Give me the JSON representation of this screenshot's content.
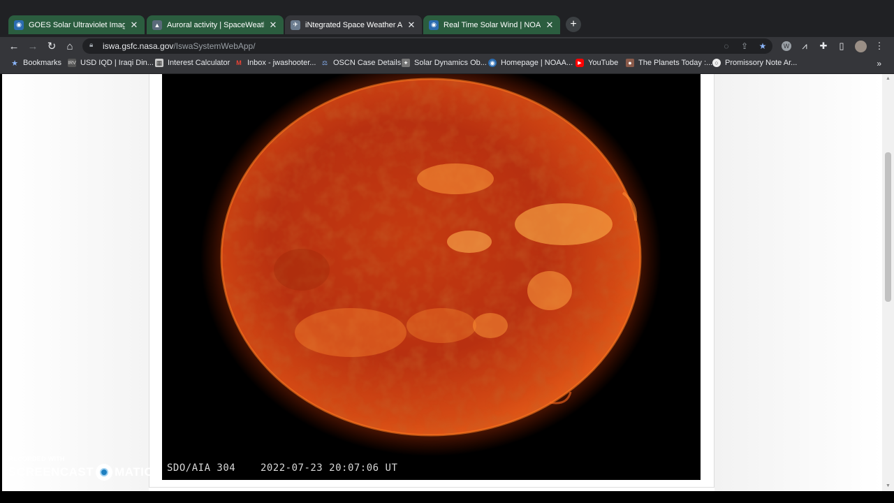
{
  "tabs": [
    {
      "title": "GOES Solar Ultraviolet Imager (SU",
      "icon": "noaa-icon",
      "color": "#2b6cb0"
    },
    {
      "title": "Auroral activity | SpaceWeatherLi",
      "icon": "aurora-icon",
      "color": "#5a6a7a"
    },
    {
      "title": "iNtegrated Space Weather Analy",
      "icon": "nasa-icon",
      "color": "#6b7c8f"
    },
    {
      "title": "Real Time Solar Wind | NOAA / N",
      "icon": "noaa-icon",
      "color": "#2b6cb0"
    }
  ],
  "address": {
    "host": "iswa.gsfc.nasa.gov",
    "path": "/IswaSystemWebApp/"
  },
  "bookmarks": [
    {
      "label": "Bookmarks",
      "icon": "star-icon"
    },
    {
      "label": "USD IQD | Iraqi Din...",
      "icon": "currency-icon"
    },
    {
      "label": "Interest Calculator",
      "icon": "calculator-icon"
    },
    {
      "label": "Inbox - jwashooter...",
      "icon": "gmail-icon"
    },
    {
      "label": "OSCN Case Details",
      "icon": "scales-icon"
    },
    {
      "label": "Solar Dynamics Ob...",
      "icon": "sdo-icon"
    },
    {
      "label": "Homepage | NOAA...",
      "icon": "noaa-icon"
    },
    {
      "label": "YouTube",
      "icon": "youtube-icon"
    },
    {
      "label": "The Planets Today :...",
      "icon": "planets-icon"
    },
    {
      "label": "Promissory Note Ar...",
      "icon": "document-icon"
    }
  ],
  "bookmarks_more": "»",
  "sun_image": {
    "instrument": "SDO/AIA 304",
    "timestamp": "2022-07-23 20:07:06 UT"
  },
  "watermark": {
    "line1": "RECORDED WITH",
    "brand_left": "SCREENCAST",
    "brand_right": "MATIC"
  },
  "colors": {
    "accent": "#8ab4f8",
    "tab_green": "#2b5d3f",
    "toolbar": "#35363a"
  }
}
